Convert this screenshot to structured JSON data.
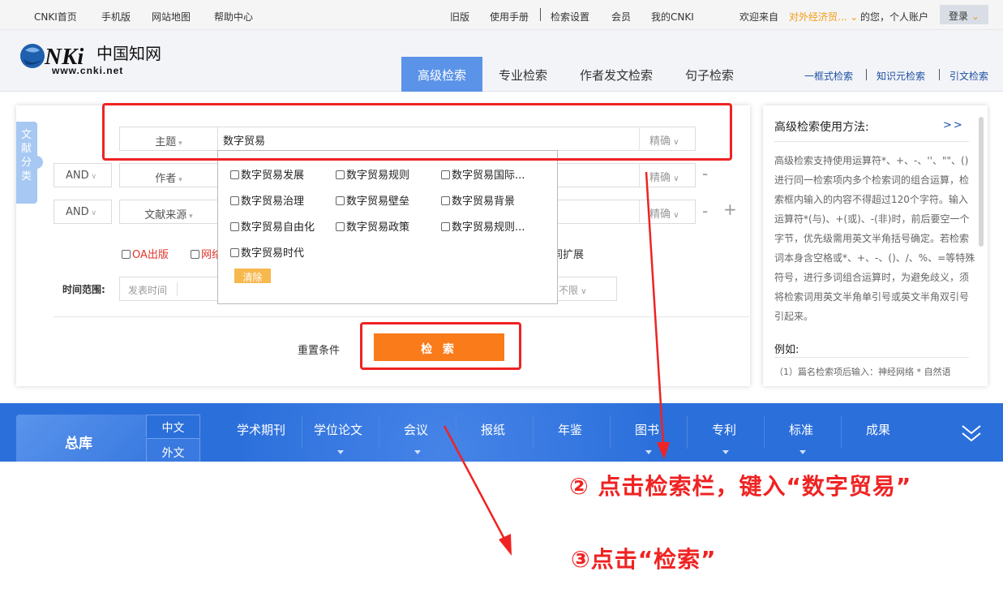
{
  "topbar": {
    "links_left": [
      "CNKI首页",
      "手机版",
      "网站地图",
      "帮助中心"
    ],
    "links_right": [
      "旧版",
      "使用手册",
      "检索设置",
      "会员",
      "我的CNKI"
    ],
    "welcome": "欢迎来自",
    "org": "对外经济贸...",
    "greeting": "的您，个人账户",
    "login": "登录"
  },
  "header": {
    "logo_text": "www.cnki.net",
    "tabs": [
      "高级检索",
      "专业检索",
      "作者发文检索",
      "句子检索"
    ],
    "active_tab": "高级检索",
    "right_links": [
      "一框式检索",
      "知识元检索",
      "引文检索"
    ]
  },
  "sidebar_tag": "文献分类",
  "search": {
    "rows": [
      {
        "field": "主题",
        "value": "数字贸易",
        "exact": "精确"
      },
      {
        "logic": "AND",
        "field": "作者",
        "exact": "精确",
        "control": "-"
      },
      {
        "logic": "AND",
        "field": "文献来源",
        "exact": "精确",
        "controls": [
          "-",
          "+"
        ]
      }
    ],
    "options_left": [
      "OA出版",
      "网络"
    ],
    "option_right": "同义词扩展",
    "time_label": "时间范围:",
    "time_placeholder": "发表时间",
    "update_value": "不限",
    "reset": "重置条件",
    "search_button": "检 索"
  },
  "suggestions": {
    "items": [
      "数字贸易发展",
      "数字贸易规则",
      "数字贸易国际...",
      "数字贸易治理",
      "数字贸易壁垒",
      "数字贸易背景",
      "数字贸易自由化",
      "数字贸易政策",
      "数字贸易规则...",
      "数字贸易时代"
    ],
    "clear": "清除"
  },
  "help": {
    "title": "高级检索使用方法:",
    "more": ">>",
    "body": "高级检索支持使用运算符*、+、-、''、\"\"、()进行同一检索项内多个检索词的组合运算，检索框内输入的内容不得超过120个字符。输入运算符*(与)、+(或)、-(非)时，前后要空一个字节，优先级需用英文半角括号确定。若检索词本身含空格或*、+、-、()、/、%、=等特殊符号，进行多词组合运算时，为避免歧义，须将检索词用英文半角单引号或英文半角双引号引起来。",
    "example_title": "例如:",
    "example_1": "（1）篇名检索项后输入：神经网络 * 自然语"
  },
  "dbbar": {
    "main": "总库",
    "lang_cn": "中文",
    "lang_en": "外文",
    "items": [
      "学术期刊",
      "学位论文",
      "会议",
      "报纸",
      "年鉴",
      "图书",
      "专利",
      "标准",
      "成果"
    ]
  },
  "annotations": {
    "step2": "② 点击检索栏，键入“数字贸易”",
    "step3": "③点击“检索”",
    "color": "#ef2323"
  }
}
